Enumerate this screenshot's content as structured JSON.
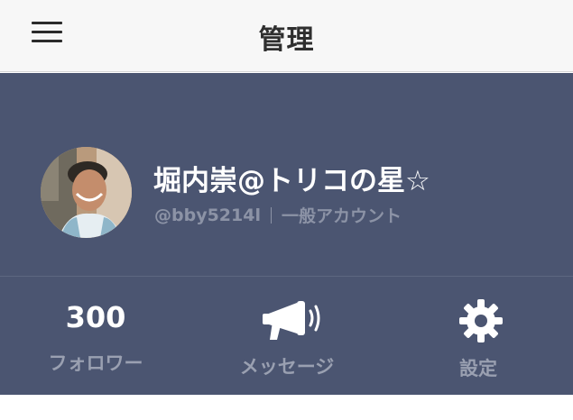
{
  "navbar": {
    "title": "管理",
    "menu_icon": "hamburger-menu-icon"
  },
  "profile": {
    "name": "堀内崇@トリコの星☆",
    "handle": "@bby5214l",
    "account_type": "一般アカウント",
    "avatar": "profile-photo"
  },
  "actions": {
    "followers": {
      "count": "300",
      "label": "フォロワー"
    },
    "messages": {
      "label": "メッセージ",
      "icon": "megaphone-icon"
    },
    "settings": {
      "label": "設定",
      "icon": "gear-icon"
    }
  },
  "colors": {
    "navbar_bg": "#f7f7f7",
    "panel_bg": "#4b5571",
    "text_primary": "#ffffff",
    "text_secondary": "#9aa0b1"
  }
}
